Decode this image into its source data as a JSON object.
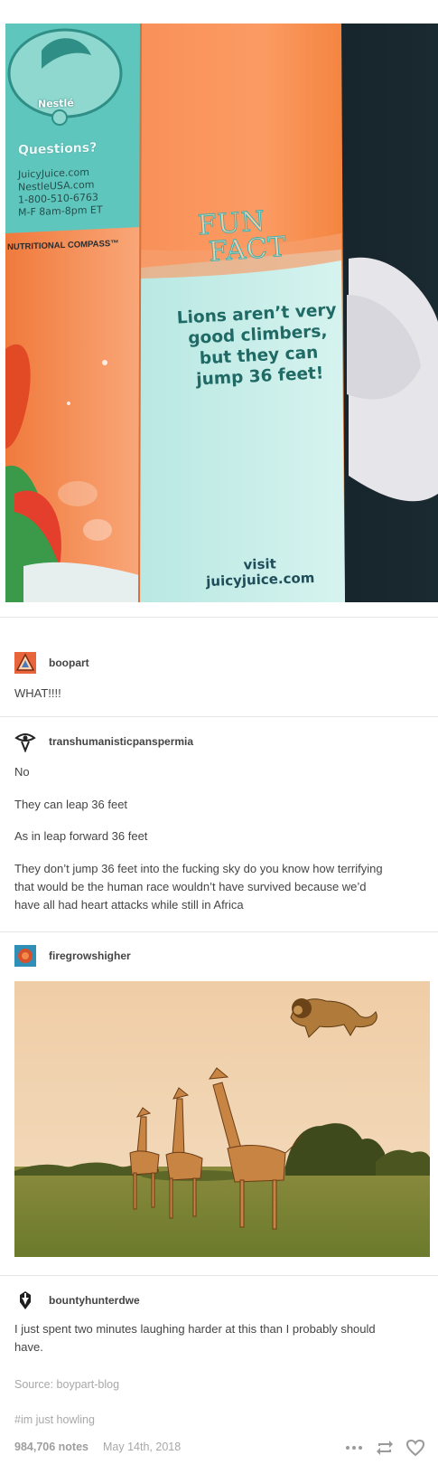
{
  "photo": {
    "brand": "Nestlé",
    "questions": "Questions?",
    "contact_lines": [
      "JuicyJuice.com",
      "NestleUSA.com",
      "1-800-510-6763",
      "M-F 8am-8pm ET"
    ],
    "compass": "NUTRITIONAL COMPASS™",
    "fun_fact_title": [
      "FUN",
      "FACT"
    ],
    "fact_text": "Lions aren’t very good climbers, but they can jump 36 feet!",
    "visit_lines": [
      "visit",
      "juicyjuice.com"
    ]
  },
  "posts": [
    {
      "username": "boopart",
      "avatar_icon": "triangle-avatar-icon",
      "paragraphs": [
        "WHAT!!!!"
      ]
    },
    {
      "username": "transhumanisticpanspermia",
      "avatar_icon": "eye-avatar-icon",
      "paragraphs": [
        "No",
        "They can leap 36 feet",
        "As in leap forward 36 feet",
        "They don’t jump 36 feet into the fucking sky do you know how terrifying that would be the human race wouldn’t have survived because we’d have all had heart attacks while still in Africa"
      ]
    },
    {
      "username": "firegrowshigher",
      "avatar_icon": "circle-avatar-icon",
      "image": "giraffes-with-flying-lion"
    },
    {
      "username": "bountyhunterdwe",
      "avatar_icon": "mandalorian-avatar-icon",
      "paragraphs": [
        "I just spent two minutes laughing harder at this than I probably should have."
      ]
    }
  ],
  "source_text": "Source: boypart-blog",
  "tag": "#im just howling",
  "notes": "984,706 notes",
  "date": "May 14th, 2018",
  "actions": [
    "more-icon",
    "reblog-icon",
    "heart-icon"
  ],
  "colors": {
    "text": "#444444",
    "muted": "#a8a8a8",
    "divider": "#e6e6e6",
    "carton_orange": "#f5894f",
    "carton_teal": "#bfe9e4"
  }
}
